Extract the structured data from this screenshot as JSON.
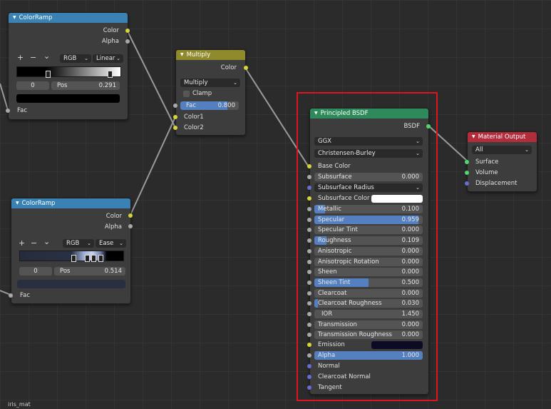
{
  "colorramp1": {
    "title": "ColorRamp",
    "out_color": "Color",
    "out_alpha": "Alpha",
    "plus": "+",
    "minus": "−",
    "menu_chevron": "⌄",
    "color_mode": "RGB",
    "interpolation": "Linear",
    "stop_index": "0",
    "pos_label": "Pos",
    "pos_value": "0.291",
    "in_fac": "Fac"
  },
  "colorramp2": {
    "title": "ColorRamp",
    "out_color": "Color",
    "out_alpha": "Alpha",
    "plus": "+",
    "minus": "−",
    "menu_chevron": "⌄",
    "color_mode": "RGB",
    "interpolation": "Ease",
    "stop_index": "0",
    "pos_label": "Pos",
    "pos_value": "0.514",
    "in_fac": "Fac"
  },
  "multiply": {
    "title": "Multiply",
    "out_color": "Color",
    "blend_mode": "Multiply",
    "clamp_label": "Clamp",
    "fac_label": "Fac",
    "fac_value": "0.800",
    "fac_fraction": 0.8,
    "in_color1": "Color1",
    "in_color2": "Color2"
  },
  "bsdf": {
    "title": "Principled BSDF",
    "out": "BSDF",
    "distribution": "GGX",
    "subsurface_method": "Christensen-Burley",
    "base_color": "Base Color",
    "subsurface_label": "Subsurface",
    "subsurface_value": "0.000",
    "subsurface_radius": "Subsurface Radius",
    "subsurface_color": "Subsurface Color",
    "params": [
      {
        "label": "Metallic",
        "value": "0.100",
        "fraction": 0.1
      },
      {
        "label": "Specular",
        "value": "0.959",
        "fraction": 0.959
      },
      {
        "label": "Specular Tint",
        "value": "0.000",
        "fraction": 0
      },
      {
        "label": "Roughness",
        "value": "0.109",
        "fraction": 0.109
      },
      {
        "label": "Anisotropic",
        "value": "0.000",
        "fraction": 0
      },
      {
        "label": "Anisotropic Rotation",
        "value": "0.000",
        "fraction": 0
      },
      {
        "label": "Sheen",
        "value": "0.000",
        "fraction": 0
      },
      {
        "label": "Sheen Tint",
        "value": "0.500",
        "fraction": 0.5
      },
      {
        "label": "Clearcoat",
        "value": "0.000",
        "fraction": 0
      },
      {
        "label": "Clearcoat Roughness",
        "value": "0.030",
        "fraction": 0.03
      },
      {
        "label": "IOR",
        "value": "1.450",
        "fraction": 0
      },
      {
        "label": "Transmission",
        "value": "0.000",
        "fraction": 0
      },
      {
        "label": "Transmission Roughness",
        "value": "0.000",
        "fraction": 0
      }
    ],
    "emission": "Emission",
    "alpha_label": "Alpha",
    "alpha_value": "1.000",
    "alpha_fraction": 1.0,
    "normal": "Normal",
    "clearcoat_normal": "Clearcoat Normal",
    "tangent": "Tangent"
  },
  "output": {
    "title": "Material Output",
    "target": "All",
    "surface": "Surface",
    "volume": "Volume",
    "displacement": "Displacement"
  },
  "footer_label": "iris_mat",
  "colors": {
    "accent": "#5580c0",
    "highlight": "#e0141e",
    "emission_swatch": "#0b0b24",
    "subsurface_swatch": "#ffffff"
  },
  "dropdown_chevron": "⌄",
  "collapse_triangle": "▼"
}
